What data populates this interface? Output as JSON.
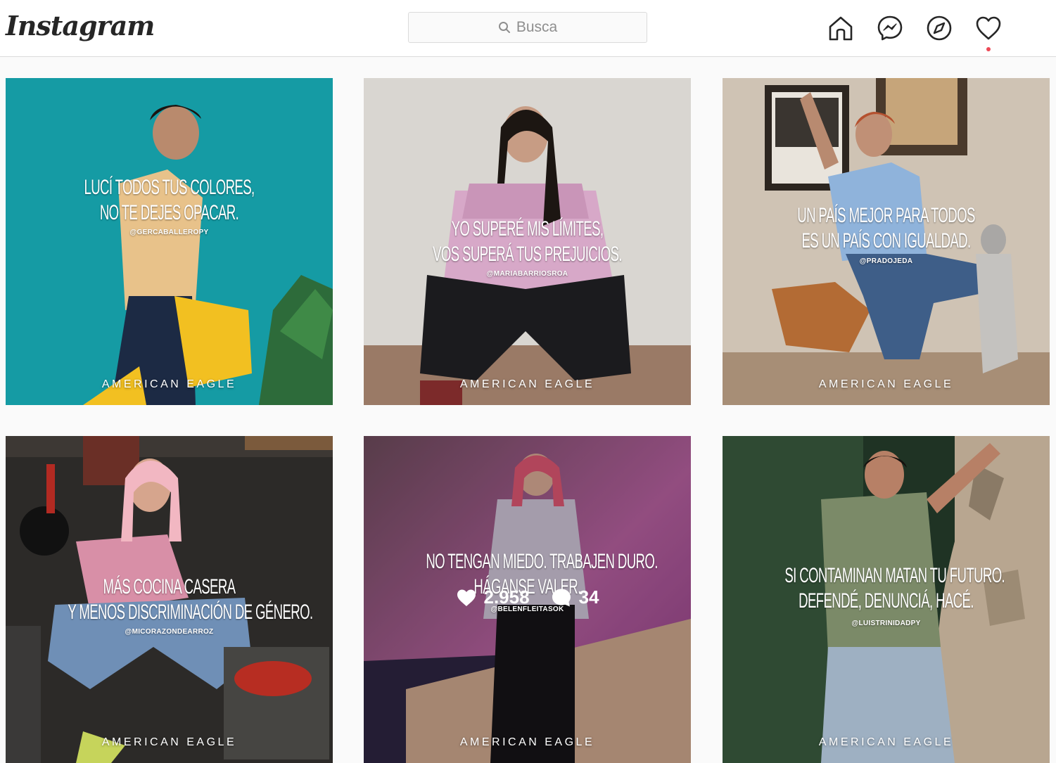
{
  "header": {
    "logo": "Instagram",
    "search_placeholder": "Busca",
    "icons": [
      "home-icon",
      "messenger-icon",
      "explore-icon",
      "activity-heart-icon"
    ],
    "notification_dot_color": "#ed4956"
  },
  "posts": [
    {
      "caption_line1": "LUCÍ TODOS TUS COLORES,",
      "caption_line2": "NO TE DEJES OPACAR.",
      "handle": "@GERCABALLEROPY",
      "brand": "AMERICAN EAGLE"
    },
    {
      "caption_line1": "YO SUPERÉ MIS LÍMITES,",
      "caption_line2": "VOS SUPERÁ TUS PREJUICIOS.",
      "handle": "@MARIABARRIOSROA",
      "brand": "AMERICAN EAGLE"
    },
    {
      "caption_line1": "UN PAÍS MEJOR PARA TODOS",
      "caption_line2": "ES UN PAÍS CON IGUALDAD.",
      "handle": "@PRADOJEDA",
      "brand": "AMERICAN EAGLE"
    },
    {
      "caption_line1": "MÁS COCINA CASERA",
      "caption_line2": "Y MENOS DISCRIMINACIÓN DE GÉNERO.",
      "handle": "@MICORAZONDEARROZ",
      "brand": "AMERICAN EAGLE"
    },
    {
      "caption_line1": "NO TENGAN MIEDO. TRABAJEN DURO.",
      "caption_line2": "HÁGANSE VALER.",
      "handle": "@BELENFLEITASOK",
      "brand": "AMERICAN EAGLE",
      "likes": "2.958",
      "comments": "34"
    },
    {
      "caption_line1": "SI CONTAMINAN MATAN TU FUTURO.",
      "caption_line2": "DEFENDÉ, DENUNCIÁ, HACÉ.",
      "handle": "@LUISTRINIDADPY",
      "brand": "AMERICAN EAGLE"
    }
  ]
}
